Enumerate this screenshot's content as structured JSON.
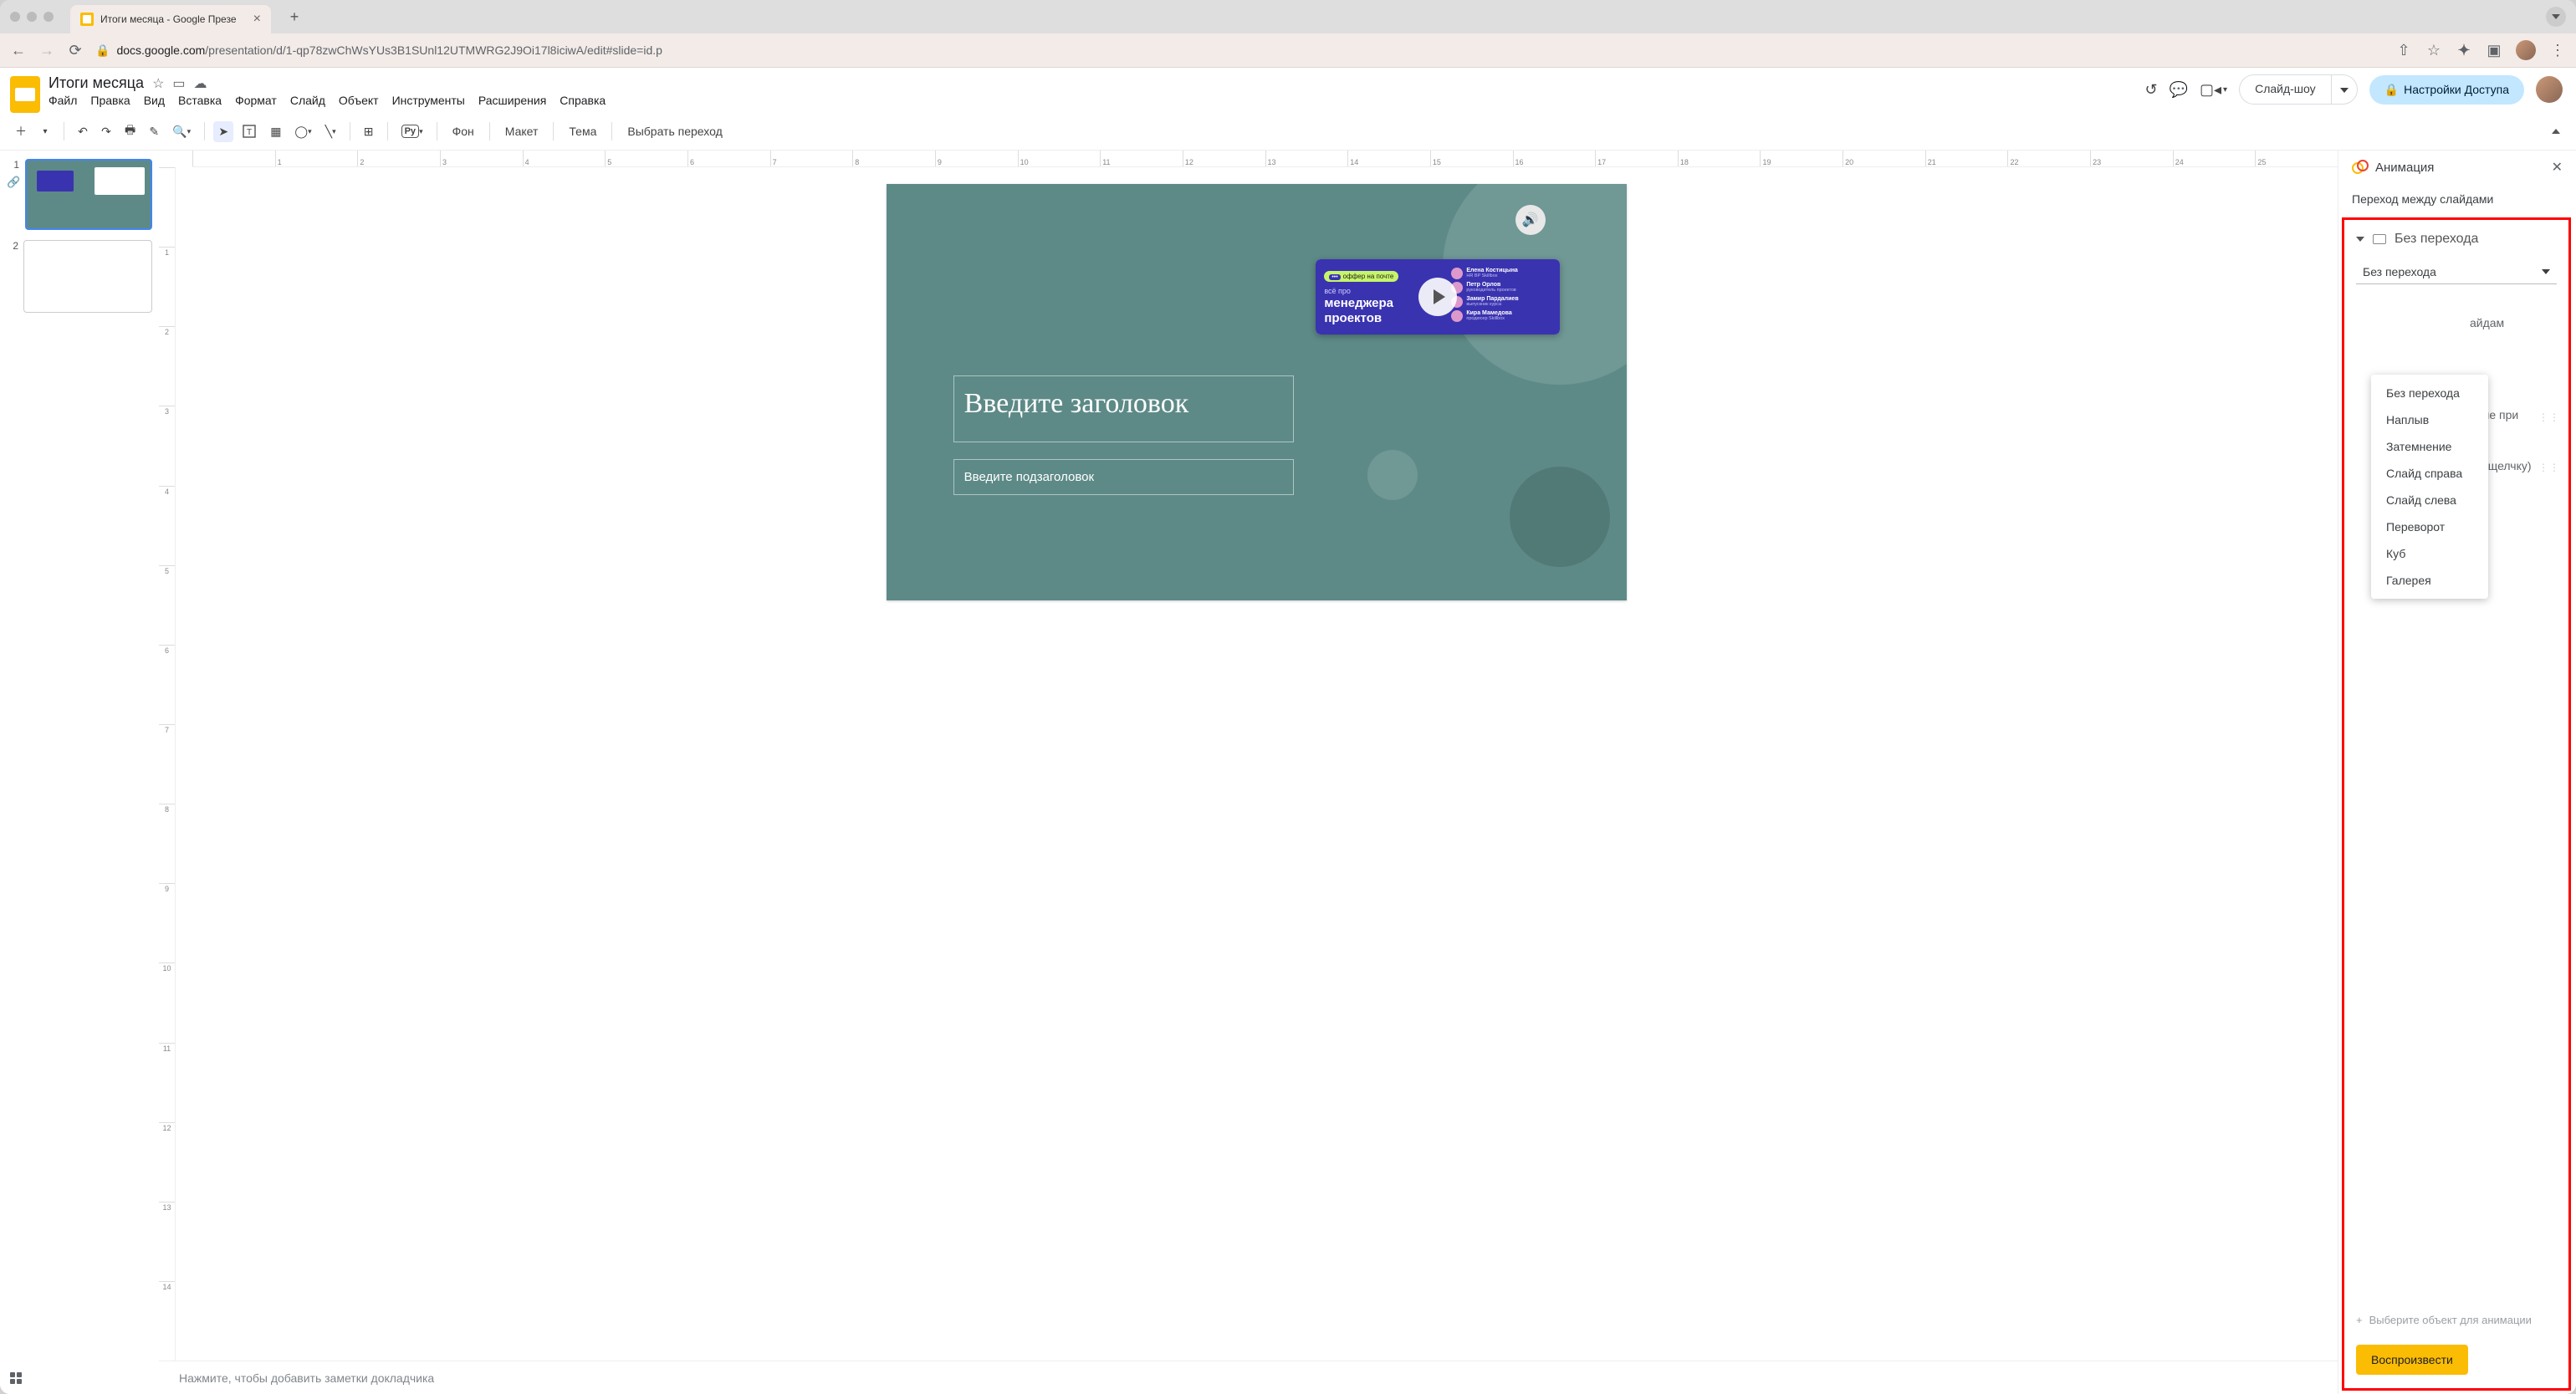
{
  "browser": {
    "tab_title": "Итоги месяца - Google Презе",
    "url_host": "docs.google.com",
    "url_path": "/presentation/d/1-qp78zwChWsYUs3B1SUnl12UTMWRG2J9Oi17l8iciwA/edit#slide=id.p"
  },
  "doc": {
    "title": "Итоги месяца",
    "menus": [
      "Файл",
      "Правка",
      "Вид",
      "Вставка",
      "Формат",
      "Слайд",
      "Объект",
      "Инструменты",
      "Расширения",
      "Справка"
    ],
    "slideshow_label": "Слайд-шоу",
    "share_label": "Настройки Доступа"
  },
  "toolbar": {
    "bg_label": "Фон",
    "layout_label": "Макет",
    "theme_label": "Тема",
    "transition_label": "Выбрать переход"
  },
  "ruler_h": [
    "",
    "1",
    "2",
    "3",
    "4",
    "5",
    "6",
    "7",
    "8",
    "9",
    "10",
    "11",
    "12",
    "13",
    "14",
    "15",
    "16",
    "17",
    "18",
    "19",
    "20",
    "21",
    "22",
    "23",
    "24",
    "25"
  ],
  "ruler_v": [
    "",
    "1",
    "2",
    "3",
    "4",
    "5",
    "6",
    "7",
    "8",
    "9",
    "10",
    "11",
    "12",
    "13",
    "14"
  ],
  "filmstrip": {
    "slide1_num": "1",
    "slide2_num": "2"
  },
  "slide": {
    "title_placeholder": "Введите заголовок",
    "subtitle_placeholder": "Введите подзаголовок",
    "video_pill": "оффер на почте",
    "video_sub": "всё про",
    "video_main1": "менеджера",
    "video_main2": "проектов",
    "people": [
      {
        "name": "Елена Костицына",
        "role": "HR BP Skillbox"
      },
      {
        "name": "Петр Орлов",
        "role": "руководитель проектов"
      },
      {
        "name": "Замир Пардалиев",
        "role": "выпускник курса"
      },
      {
        "name": "Кира Мамедова",
        "role": "продюсер Skillbox"
      }
    ]
  },
  "notes_placeholder": "Нажмите, чтобы добавить заметки докладчика",
  "panel": {
    "title": "Анимация",
    "section": "Переход между слайдами",
    "current_transition": "Без перехода",
    "dropdown_value": "Без перехода",
    "options": [
      "Без перехода",
      "Наплыв",
      "Затемнение",
      "Слайд справа",
      "Слайд слева",
      "Переворот",
      "Куб",
      "Галерея"
    ],
    "hidden1": "айдам",
    "hidden2": "ение при",
    "hidden3": "По щелчку)",
    "add_anim": "Выберите объект для анимации",
    "play": "Воспроизвести"
  }
}
